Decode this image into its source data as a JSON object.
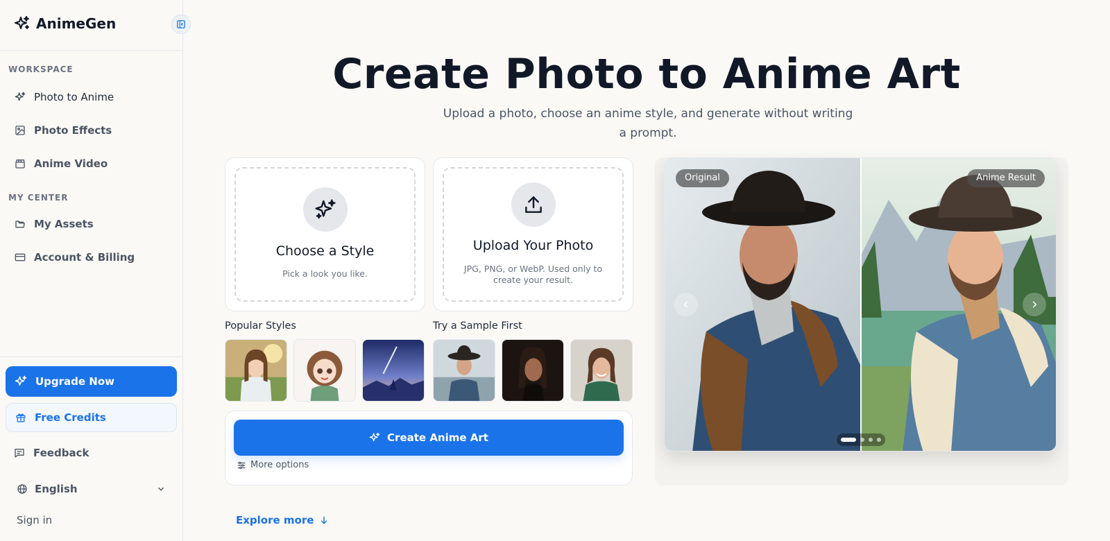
{
  "brand": {
    "name": "AnimeGen"
  },
  "sidebar": {
    "workspace_label": "WORKSPACE",
    "workspace_items": [
      {
        "label": "Photo to Anime",
        "icon": "sparkles-icon"
      },
      {
        "label": "Photo Effects",
        "icon": "image-icon"
      },
      {
        "label": "Anime Video",
        "icon": "clapperboard-icon"
      }
    ],
    "center_label": "MY CENTER",
    "center_items": [
      {
        "label": "My Assets",
        "icon": "folder-icon"
      },
      {
        "label": "Account & Billing",
        "icon": "credit-card-icon"
      }
    ],
    "upgrade_label": "Upgrade Now",
    "credits_label": "Free Credits",
    "feedback_label": "Feedback",
    "language": "English",
    "signin_label": "Sign in"
  },
  "hero": {
    "title": "Create Photo to Anime Art",
    "subtitle": "Upload a photo, choose an anime style, and generate without writing a prompt."
  },
  "style_card": {
    "title": "Choose a Style",
    "desc": "Pick a look you like."
  },
  "upload_card": {
    "title": "Upload Your Photo",
    "desc": "JPG, PNG, or WebP. Used only to create your result."
  },
  "popular_styles_label": "Popular Styles",
  "sample_label": "Try a Sample First",
  "create_button": "Create Anime Art",
  "more_options": "More options",
  "explore_more": "Explore more",
  "comparison": {
    "original_label": "Original",
    "result_label": "Anime Result",
    "slide_count": 4,
    "active_slide": 1
  },
  "colors": {
    "accent": "#1a73e8",
    "title": "#111827",
    "background": "#faf9f6"
  }
}
